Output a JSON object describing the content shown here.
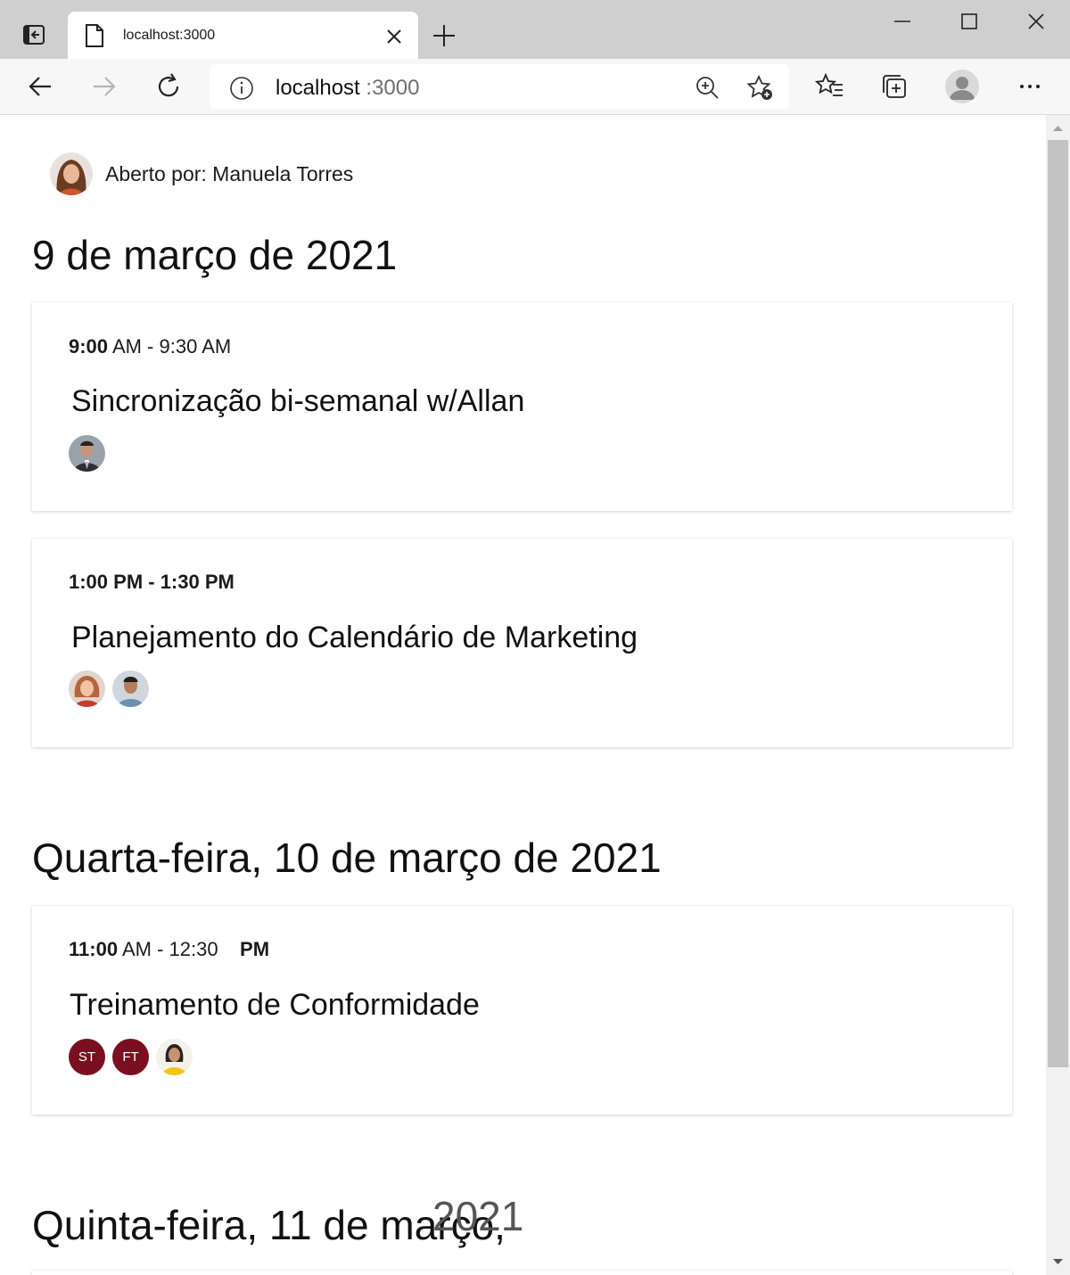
{
  "browser": {
    "tab_title": "localhost:3000",
    "url_host": "localhost",
    "url_port": ":3000",
    "icons": [
      "tab-actions-icon",
      "page-icon",
      "close-icon",
      "plus-icon",
      "minimize-icon",
      "maximize-icon",
      "window-close-icon",
      "back-icon",
      "forward-icon",
      "refresh-icon",
      "info-icon",
      "zoom-in-icon",
      "add-favorite-icon",
      "favorites-icon",
      "collections-icon",
      "profile-icon",
      "more-icon"
    ]
  },
  "page": {
    "owner_label": "Aberto por: Manuela Torres",
    "days": [
      {
        "heading": "9 de março de 2021",
        "events": [
          {
            "time_start": "9:00",
            "time_rest": " AM - 9:30 AM",
            "title": "Sincronização bi-semanal w/Allan"
          },
          {
            "time_start": "1:00 PM - 1:30 PM",
            "time_rest": "",
            "title": "Planejamento do Calendário de Marketing"
          }
        ]
      },
      {
        "heading": "Quarta-feira, 10 de março de 2021",
        "events": [
          {
            "time_start": "11:00",
            "time_rest": " AM - 12:30    ",
            "time_tail": "PM",
            "title": "Treinamento de Conformidade",
            "initials": [
              "ST",
              "FT"
            ]
          }
        ]
      },
      {
        "heading": "Quinta-feira, 11 de março,",
        "heading_extra": "2021"
      }
    ],
    "colors": {
      "initials_bg": "#7a0f22",
      "tabbar": "#cfcfcf",
      "toolbar": "#f7f7f7"
    }
  }
}
